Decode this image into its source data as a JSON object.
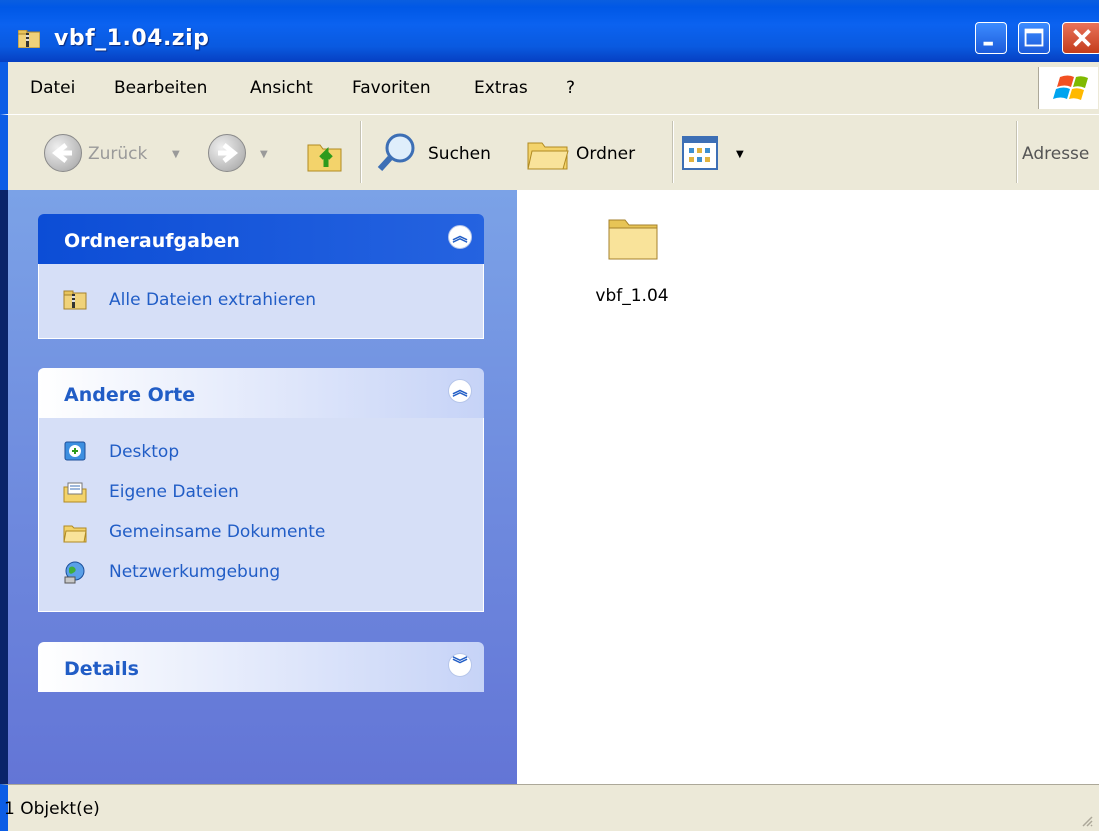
{
  "window": {
    "title": "vbf_1.04.zip"
  },
  "menu": [
    "Datei",
    "Bearbeiten",
    "Ansicht",
    "Favoriten",
    "Extras",
    "?"
  ],
  "toolbar": {
    "back_label": "Zurück",
    "search_label": "Suchen",
    "folders_label": "Ordner",
    "address_label": "Adresse"
  },
  "taskpane": {
    "folder_tasks": {
      "title": "Ordneraufgaben",
      "items": [
        {
          "label": "Alle Dateien extrahieren",
          "icon": "zip-folder-icon"
        }
      ]
    },
    "other_places": {
      "title": "Andere Orte",
      "items": [
        {
          "label": "Desktop",
          "icon": "desktop-icon"
        },
        {
          "label": "Eigene Dateien",
          "icon": "my-documents-icon"
        },
        {
          "label": "Gemeinsame Dokumente",
          "icon": "folder-icon"
        },
        {
          "label": "Netzwerkumgebung",
          "icon": "network-icon"
        }
      ]
    },
    "details": {
      "title": "Details"
    }
  },
  "content": {
    "items": [
      {
        "name": "vbf_1.04",
        "icon": "folder-icon"
      }
    ]
  },
  "status": {
    "text": "1 Objekt(e)"
  },
  "colors": {
    "titlebar": "#0058e6",
    "taskpane_top": "#7ba2e7",
    "taskpane_bottom": "#6375d6",
    "link_blue": "#215dc6",
    "chrome": "#ece9d8"
  }
}
